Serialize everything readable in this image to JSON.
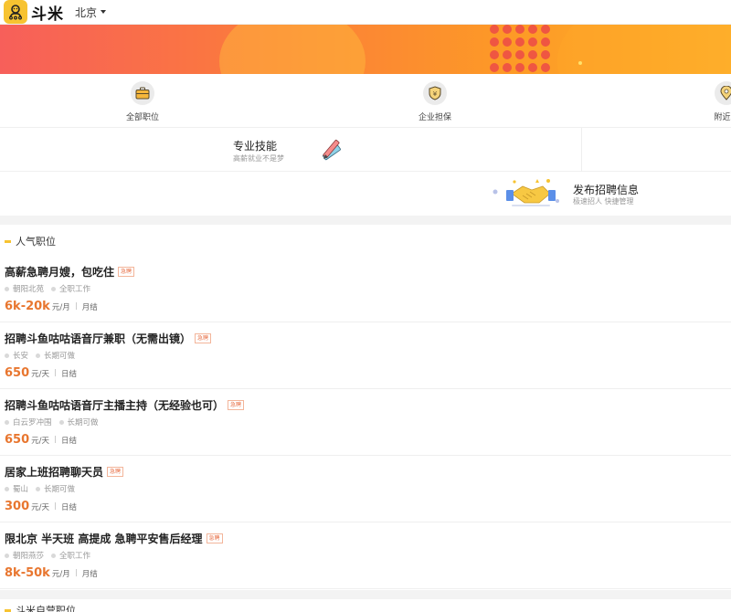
{
  "header": {
    "brand": "斗米",
    "city": "北京"
  },
  "nav": {
    "items": [
      {
        "label": "全部职位",
        "icon": "briefcase-icon"
      },
      {
        "label": "企业担保",
        "icon": "shield-icon"
      },
      {
        "label": "附近职",
        "icon": "location-pin-icon"
      }
    ]
  },
  "skills": {
    "title": "专业技能",
    "subtitle": "高薪就业不是梦"
  },
  "publish": {
    "title": "发布招聘信息",
    "subtitle": "极速招人 快捷管理"
  },
  "section": {
    "title": "人气职位",
    "next_title": "斗米自营职位"
  },
  "jobs": [
    {
      "title": "高薪急聘月嫂，包吃住",
      "tag": "急聘",
      "location": "朝阳北苑",
      "type": "全职工作",
      "salary": "6k-20k",
      "unit": "元/月",
      "settle": "月结"
    },
    {
      "title": "招聘斗鱼咕咕语音厅兼职（无需出镜）",
      "tag": "急聘",
      "location": "长安",
      "type": "长期可做",
      "salary": "650",
      "unit": "元/天",
      "settle": "日结"
    },
    {
      "title": "招聘斗鱼咕咕语音厅主播主持（无经验也可）",
      "tag": "急聘",
      "location": "白云罗冲围",
      "type": "长期可做",
      "salary": "650",
      "unit": "元/天",
      "settle": "日结"
    },
    {
      "title": "居家上班招聘聊天员",
      "tag": "急聘",
      "location": "蜀山",
      "type": "长期可做",
      "salary": "300",
      "unit": "元/天",
      "settle": "日结"
    },
    {
      "title": "限北京 半天班 高提成 急聘平安售后经理",
      "tag": "急聘",
      "location": "朝阳燕莎",
      "type": "全职工作",
      "salary": "8k-50k",
      "unit": "元/月",
      "settle": "月结"
    }
  ],
  "colors": {
    "brand_yellow": "#f7c331",
    "salary_orange": "#e8762f",
    "banner_start": "#f75f5a",
    "banner_end": "#fdb12b"
  }
}
